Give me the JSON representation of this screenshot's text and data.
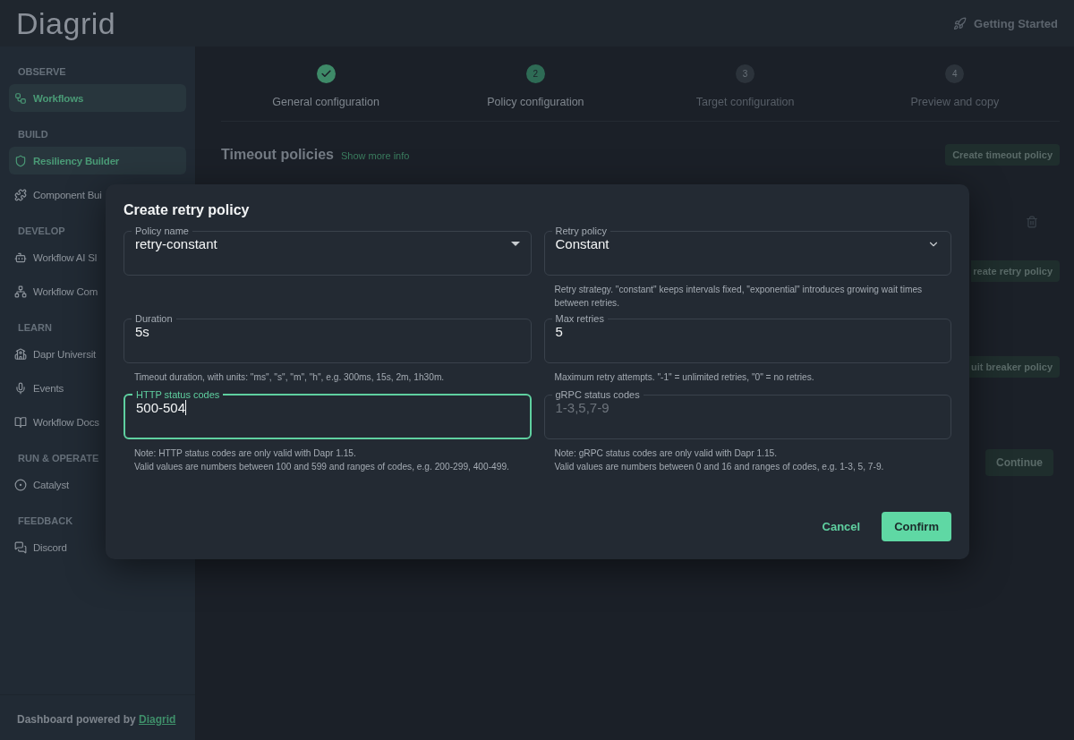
{
  "header": {
    "logo": "Diagrid",
    "getting_started": "Getting Started"
  },
  "sidebar": {
    "sections": [
      {
        "title": "OBSERVE",
        "items": [
          {
            "label": "Workflows",
            "selected": true
          }
        ]
      },
      {
        "title": "BUILD",
        "items": [
          {
            "label": "Resiliency Builder",
            "selected": true
          },
          {
            "label": "Component Bui",
            "selected": false
          }
        ]
      },
      {
        "title": "DEVELOP",
        "items": [
          {
            "label": "Workflow AI Sl",
            "selected": false
          },
          {
            "label": "Workflow Com",
            "selected": false
          }
        ]
      },
      {
        "title": "LEARN",
        "items": [
          {
            "label": "Dapr Universit",
            "selected": false
          },
          {
            "label": "Events",
            "selected": false
          },
          {
            "label": "Workflow Docs",
            "selected": false
          }
        ]
      },
      {
        "title": "RUN & OPERATE",
        "items": [
          {
            "label": "Catalyst",
            "selected": false
          }
        ]
      },
      {
        "title": "FEEDBACK",
        "items": [
          {
            "label": "Discord",
            "selected": false
          }
        ]
      }
    ],
    "footer": {
      "text": "Dashboard powered by",
      "link": "Diagrid"
    }
  },
  "stepper": [
    {
      "label": "General configuration",
      "completed": true,
      "current": false
    },
    {
      "number": "2",
      "label": "Policy configuration",
      "completed": false,
      "current": true
    },
    {
      "number": "3",
      "label": "Target configuration",
      "completed": false,
      "current": false
    },
    {
      "number": "4",
      "label": "Preview and copy",
      "completed": false,
      "current": false
    }
  ],
  "section": {
    "title": "Timeout policies",
    "link": "Show more info",
    "button": "Create timeout policy"
  },
  "background_buttons": [
    "reate retry policy",
    "uit breaker policy"
  ],
  "continue_button": "Continue",
  "dialog": {
    "title": "Create retry policy",
    "fields": [
      {
        "label": "Policy name",
        "value": "retry-constant",
        "kind": "combo",
        "focused": false
      },
      {
        "label": "Retry policy",
        "value": "Constant",
        "kind": "select",
        "focused": false,
        "helper": "Retry strategy. \"constant\" keeps intervals fixed, \"exponential\" introduces growing wait times between retries."
      },
      {
        "label": "Duration",
        "value": "5s",
        "kind": "text",
        "focused": false,
        "helper": "Timeout duration, with units: \"ms\", \"s\", \"m\", \"h\", e.g. 300ms, 15s, 2m, 1h30m."
      },
      {
        "label": "Max retries",
        "value": "5",
        "kind": "text",
        "focused": false,
        "helper": "Maximum retry attempts. \"-1\" = unlimited retries, \"0\" = no retries."
      },
      {
        "label": "HTTP status codes",
        "value": "500-504",
        "kind": "text",
        "focused": true,
        "helper": "Note: HTTP status codes are only valid with Dapr 1.15.\nValid values are numbers between 100 and 599 and ranges of codes, e.g. 200-299, 400-499."
      },
      {
        "label": "gRPC status codes",
        "placeholder": "1-3,5,7-9",
        "kind": "text",
        "focused": false,
        "helper": "Note: gRPC status codes are only valid with Dapr 1.15.\nValid values are numbers between 0 and 16 and ranges of codes, e.g. 1-3, 5, 7-9."
      }
    ],
    "buttons": {
      "cancel": "Cancel",
      "confirm": "Confirm"
    }
  }
}
